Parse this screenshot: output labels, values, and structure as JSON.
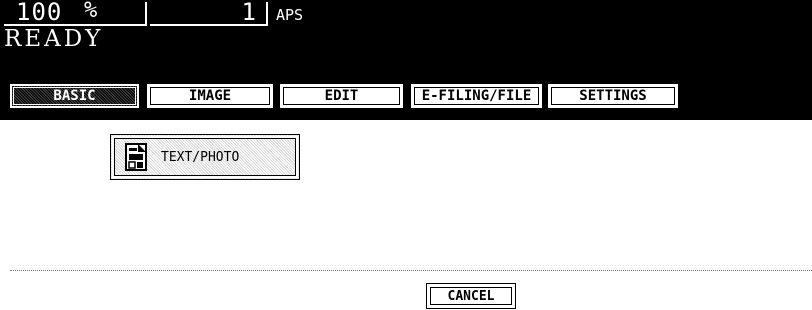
{
  "header": {
    "zoom_value": "100",
    "zoom_unit": "%",
    "copies": "1",
    "paper_mode": "APS",
    "status": "READY"
  },
  "tabs": [
    {
      "label": "BASIC",
      "active": true
    },
    {
      "label": "IMAGE",
      "active": false
    },
    {
      "label": "EDIT",
      "active": false
    },
    {
      "label": "E-FILING/FILE",
      "active": false
    },
    {
      "label": "SETTINGS",
      "active": false
    }
  ],
  "main": {
    "mode_button": {
      "label": "TEXT/PHOTO",
      "icon": "document-icon"
    }
  },
  "footer": {
    "cancel_label": "CANCEL"
  }
}
